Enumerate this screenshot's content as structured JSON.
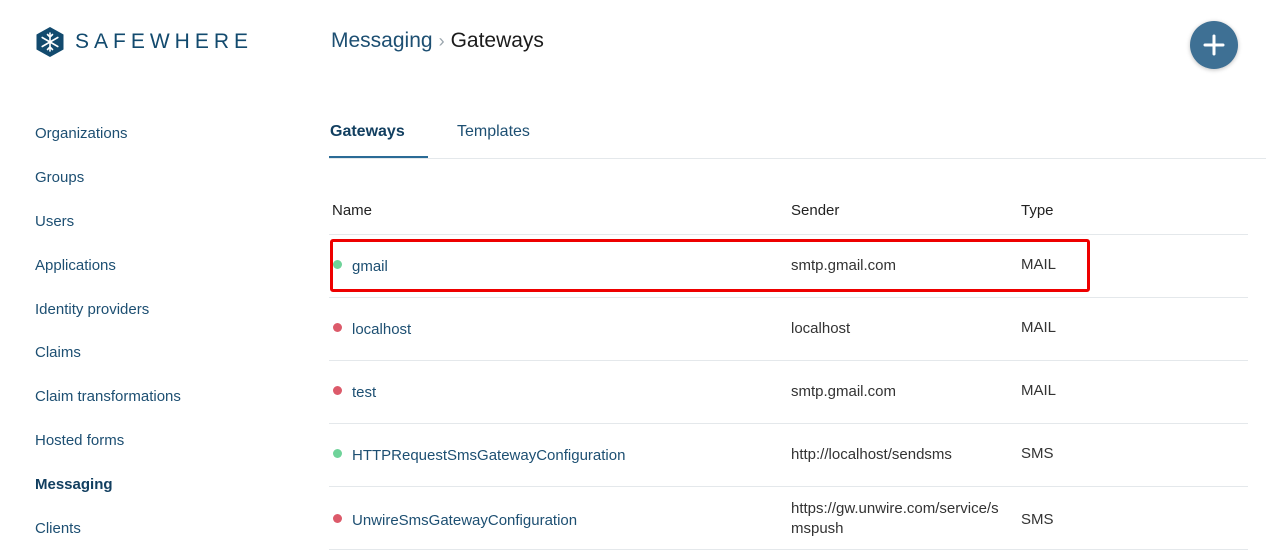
{
  "brand": {
    "name": "SAFEWHERE"
  },
  "sidebar": {
    "items": [
      {
        "label": "Organizations"
      },
      {
        "label": "Groups"
      },
      {
        "label": "Users"
      },
      {
        "label": "Applications"
      },
      {
        "label": "Identity providers"
      },
      {
        "label": "Claims"
      },
      {
        "label": "Claim transformations"
      },
      {
        "label": "Hosted forms"
      },
      {
        "label": "Messaging",
        "active": true
      },
      {
        "label": "Clients"
      }
    ]
  },
  "breadcrumb": {
    "parent": "Messaging",
    "separator": "›",
    "current": "Gateways"
  },
  "add_button": {
    "icon": "plus-icon"
  },
  "tabs": [
    {
      "label": "Gateways",
      "active": true
    },
    {
      "label": "Templates"
    }
  ],
  "table": {
    "headers": {
      "name": "Name",
      "sender": "Sender",
      "type": "Type"
    },
    "rows": [
      {
        "status": "active",
        "name": "gmail",
        "sender": "smtp.gmail.com",
        "type": "MAIL"
      },
      {
        "status": "inactive",
        "name": "localhost",
        "sender": "localhost",
        "type": "MAIL"
      },
      {
        "status": "inactive",
        "name": "test",
        "sender": "smtp.gmail.com",
        "type": "MAIL"
      },
      {
        "status": "active",
        "name": "HTTPRequestSmsGatewayConfiguration",
        "sender": "http://localhost/sendsms",
        "type": "SMS"
      },
      {
        "status": "inactive",
        "name": "UnwireSmsGatewayConfiguration",
        "sender": "https://gw.unwire.com/service/smspush",
        "type": "SMS"
      }
    ]
  },
  "colors": {
    "accent": "#1d4f72",
    "add_button": "#3e7094",
    "status_active": "#6fd39a",
    "status_inactive": "#dc5a6a",
    "highlight": "#ee0000"
  }
}
